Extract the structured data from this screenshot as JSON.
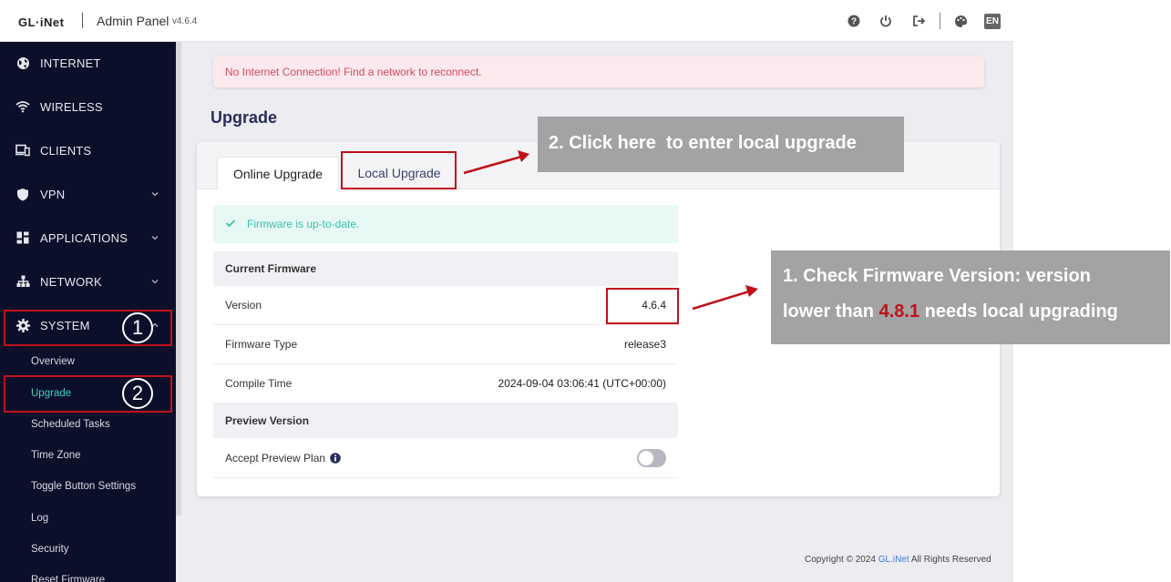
{
  "header": {
    "logo": "GL·iNet",
    "title": "Admin Panel",
    "version": "v4.6.4",
    "language": "EN"
  },
  "sidebar": {
    "items": [
      {
        "label": "INTERNET",
        "icon": "globe-icon"
      },
      {
        "label": "WIRELESS",
        "icon": "wifi-icon"
      },
      {
        "label": "CLIENTS",
        "icon": "devices-icon"
      },
      {
        "label": "VPN",
        "icon": "shield-icon",
        "expandable": true
      },
      {
        "label": "APPLICATIONS",
        "icon": "apps-grid-icon",
        "expandable": true
      },
      {
        "label": "NETWORK",
        "icon": "network-icon",
        "expandable": true
      },
      {
        "label": "SYSTEM",
        "icon": "gear-icon",
        "expanded": true
      }
    ],
    "system_subitems": [
      "Overview",
      "Upgrade",
      "Scheduled Tasks",
      "Time Zone",
      "Toggle Button Settings",
      "Log",
      "Security",
      "Reset Firmware"
    ],
    "active_subitem": "Upgrade"
  },
  "alert": {
    "text": "No Internet Connection! Find a network to reconnect."
  },
  "page": {
    "title": "Upgrade"
  },
  "tabs": [
    {
      "label": "Online Upgrade",
      "active": true
    },
    {
      "label": "Local Upgrade",
      "active": false
    }
  ],
  "status": {
    "text": "Firmware is up-to-date."
  },
  "current_firmware": {
    "heading": "Current Firmware",
    "rows": [
      {
        "label": "Version",
        "value": "4.6.4"
      },
      {
        "label": "Firmware Type",
        "value": "release3"
      },
      {
        "label": "Compile Time",
        "value": "2024-09-04 03:06:41 (UTC+00:00)"
      }
    ]
  },
  "preview": {
    "heading": "Preview Version",
    "accept_label": "Accept Preview Plan",
    "accept_enabled": false
  },
  "footer": {
    "copyright_prefix": "Copyright © 2024",
    "brand": "GL.iNet",
    "copyright_suffix": "All Rights Reserved"
  },
  "annotations": {
    "step1_marker": "1",
    "step2_marker": "2",
    "callout2": "2. Click here  to enter local upgrade",
    "callout1_line1": "1. Check Firmware Version: version",
    "callout1_line2_prefix": "lower than ",
    "callout1_highlight": "4.8.1",
    "callout1_line2_suffix": " needs local upgrading",
    "annotation_color": "#c0111a",
    "callout_bg": "#a3a3a3"
  },
  "colors": {
    "sidebar_bg": "#0c0f2a",
    "accent_active": "#3ed3c0",
    "alert_text": "#d8495f",
    "link": "#3e7ed8"
  }
}
